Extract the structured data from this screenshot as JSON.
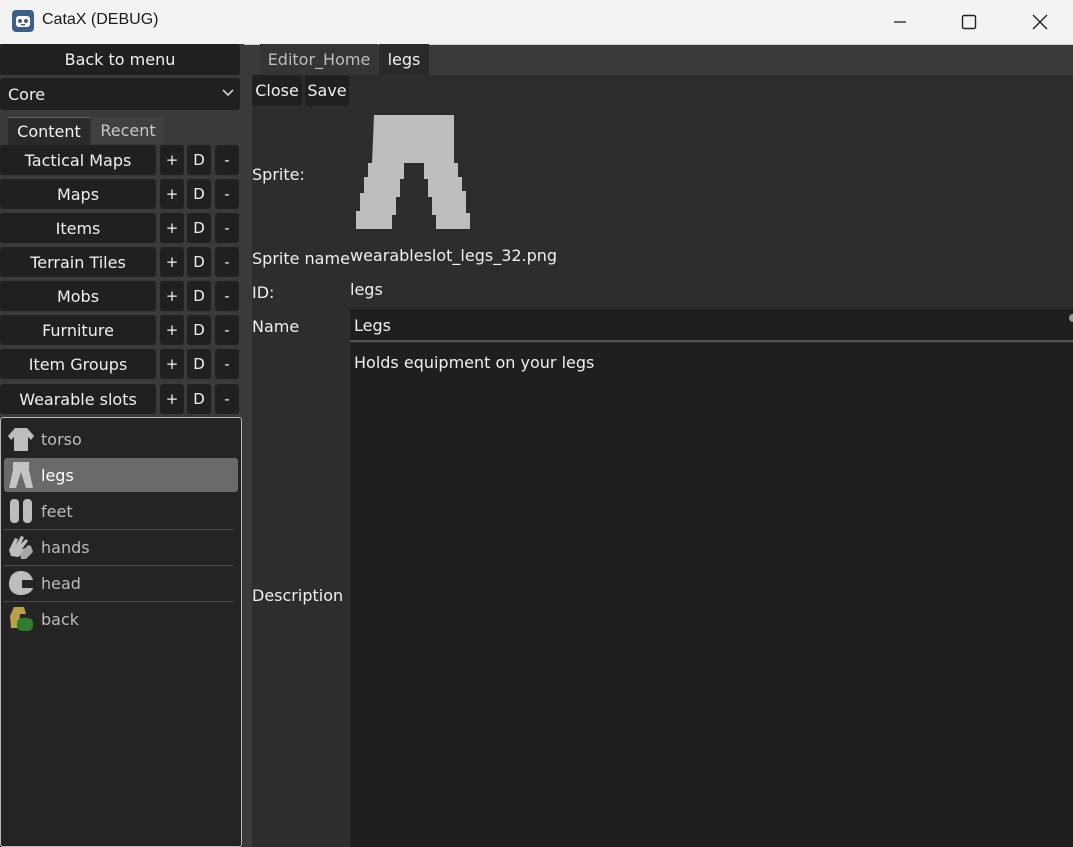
{
  "window": {
    "title": "CataX (DEBUG)",
    "app_icon": "godot-icon",
    "controls": [
      "minimize-icon",
      "maximize-icon",
      "close-icon"
    ]
  },
  "left_panel": {
    "back_label": "Back to menu",
    "mod_select": {
      "value": "Core",
      "icon": "chevron-down-icon"
    },
    "tabs": {
      "content": "Content",
      "recent": "Recent"
    },
    "categories": [
      {
        "label": "Tactical Maps"
      },
      {
        "label": "Maps"
      },
      {
        "label": "Items"
      },
      {
        "label": "Terrain Tiles"
      },
      {
        "label": "Mobs"
      },
      {
        "label": "Furniture"
      },
      {
        "label": "Item Groups"
      },
      {
        "label": "Wearable slots"
      }
    ],
    "category_buttons": {
      "add": "+",
      "duplicate": "D",
      "remove": "-"
    },
    "slots": [
      {
        "label": "torso",
        "icon": "torso-icon"
      },
      {
        "label": "legs",
        "icon": "legs-icon",
        "selected": true
      },
      {
        "label": "feet",
        "icon": "feet-icon"
      },
      {
        "label": "hands",
        "icon": "hands-icon"
      },
      {
        "label": "head",
        "icon": "head-icon"
      },
      {
        "label": "back",
        "icon": "backpack-icon"
      }
    ]
  },
  "editor": {
    "tabs": {
      "home": "Editor_Home",
      "current": "legs"
    },
    "toolbar": {
      "close": "Close",
      "save": "Save"
    },
    "labels": {
      "sprite": "Sprite:",
      "sprite_name": "Sprite name",
      "id": "ID:",
      "name": "Name",
      "description": "Description"
    },
    "values": {
      "sprite_name": "wearableslot_legs_32.png",
      "id": "legs",
      "name": "Legs",
      "description": "Holds equipment on your legs"
    }
  },
  "colors": {
    "background": "#3a3a3a",
    "panel": "#2d2d2d",
    "button": "#202020",
    "selected": "#6a6a6a",
    "sprite_gray": "#bdbdbd"
  }
}
